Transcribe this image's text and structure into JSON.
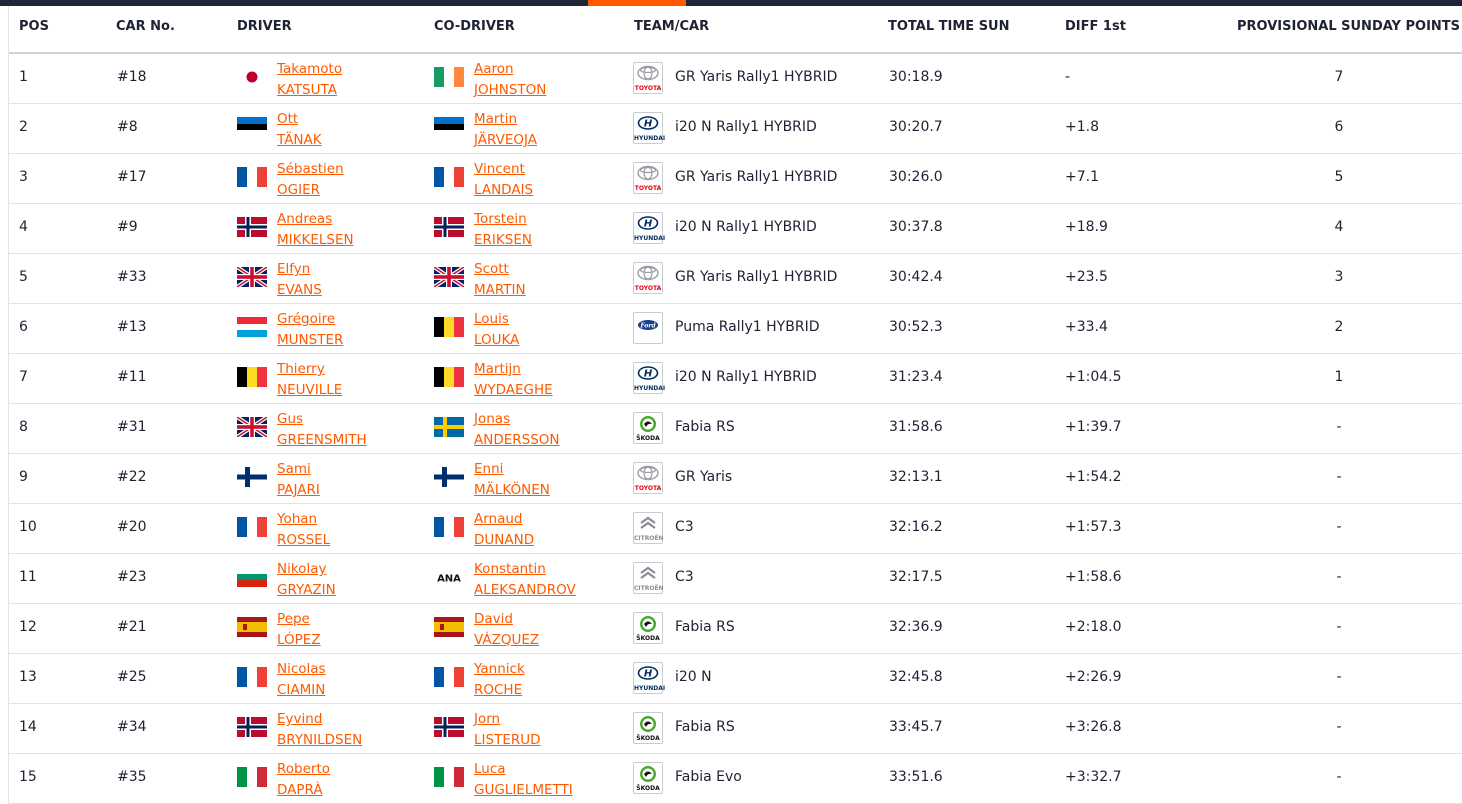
{
  "headers": {
    "pos": "POS",
    "car": "CAR No.",
    "driver": "DRIVER",
    "codriver": "CO-DRIVER",
    "team": "TEAM/CAR",
    "total": "TOTAL TIME SUN",
    "diff": "DIFF 1st",
    "points": "PROVISIONAL SUNDAY POINTS"
  },
  "rows": [
    {
      "pos": "1",
      "car": "#18",
      "driver_first": "Takamoto",
      "driver_last": "KATSUTA",
      "driver_flag": "JPN",
      "codriver_first": "Aaron",
      "codriver_last": "JOHNSTON",
      "codriver_flag": "IRL",
      "brand": "toyota",
      "brand_label": "TOYOTA",
      "model": "GR Yaris Rally1 HYBRID",
      "time": "30:18.9",
      "diff": "-",
      "points": "7"
    },
    {
      "pos": "2",
      "car": "#8",
      "driver_first": "Ott",
      "driver_last": "TÄNAK",
      "driver_flag": "EST",
      "codriver_first": "Martin",
      "codriver_last": "JÄRVEOJA",
      "codriver_flag": "EST",
      "brand": "hyundai",
      "brand_label": "HYUNDAI",
      "model": "i20 N Rally1 HYBRID",
      "time": "30:20.7",
      "diff": "+1.8",
      "points": "6"
    },
    {
      "pos": "3",
      "car": "#17",
      "driver_first": "Sébastien",
      "driver_last": "OGIER",
      "driver_flag": "FRA",
      "codriver_first": "Vincent",
      "codriver_last": "LANDAIS",
      "codriver_flag": "FRA",
      "brand": "toyota",
      "brand_label": "TOYOTA",
      "model": "GR Yaris Rally1 HYBRID",
      "time": "30:26.0",
      "diff": "+7.1",
      "points": "5"
    },
    {
      "pos": "4",
      "car": "#9",
      "driver_first": "Andreas",
      "driver_last": "MIKKELSEN",
      "driver_flag": "NOR",
      "codriver_first": "Torstein",
      "codriver_last": "ERIKSEN",
      "codriver_flag": "NOR",
      "brand": "hyundai",
      "brand_label": "HYUNDAI",
      "model": "i20 N Rally1 HYBRID",
      "time": "30:37.8",
      "diff": "+18.9",
      "points": "4"
    },
    {
      "pos": "5",
      "car": "#33",
      "driver_first": "Elfyn",
      "driver_last": "EVANS",
      "driver_flag": "GBR",
      "codriver_first": "Scott",
      "codriver_last": "MARTIN",
      "codriver_flag": "GBR",
      "brand": "toyota",
      "brand_label": "TOYOTA",
      "model": "GR Yaris Rally1 HYBRID",
      "time": "30:42.4",
      "diff": "+23.5",
      "points": "3"
    },
    {
      "pos": "6",
      "car": "#13",
      "driver_first": "Grégoire",
      "driver_last": "MUNSTER",
      "driver_flag": "LUX",
      "codriver_first": "Louis",
      "codriver_last": "LOUKA",
      "codriver_flag": "BEL",
      "brand": "ford",
      "brand_label": "Ford",
      "model": "Puma Rally1 HYBRID",
      "time": "30:52.3",
      "diff": "+33.4",
      "points": "2"
    },
    {
      "pos": "7",
      "car": "#11",
      "driver_first": "Thierry",
      "driver_last": "NEUVILLE",
      "driver_flag": "BEL",
      "codriver_first": "Martijn",
      "codriver_last": "WYDAEGHE",
      "codriver_flag": "BEL",
      "brand": "hyundai",
      "brand_label": "HYUNDAI",
      "model": "i20 N Rally1 HYBRID",
      "time": "31:23.4",
      "diff": "+1:04.5",
      "points": "1"
    },
    {
      "pos": "8",
      "car": "#31",
      "driver_first": "Gus",
      "driver_last": "GREENSMITH",
      "driver_flag": "GBR",
      "codriver_first": "Jonas",
      "codriver_last": "ANDERSSON",
      "codriver_flag": "SWE",
      "brand": "skoda",
      "brand_label": "ŠKODA",
      "model": "Fabia RS",
      "time": "31:58.6",
      "diff": "+1:39.7",
      "points": "-"
    },
    {
      "pos": "9",
      "car": "#22",
      "driver_first": "Sami",
      "driver_last": "PAJARI",
      "driver_flag": "FIN",
      "codriver_first": "Enni",
      "codriver_last": "MÄLKÖNEN",
      "codriver_flag": "FIN",
      "brand": "toyota",
      "brand_label": "TOYOTA",
      "model": "GR Yaris",
      "time": "32:13.1",
      "diff": "+1:54.2",
      "points": "-"
    },
    {
      "pos": "10",
      "car": "#20",
      "driver_first": "Yohan",
      "driver_last": "ROSSEL",
      "driver_flag": "FRA",
      "codriver_first": "Arnaud",
      "codriver_last": "DUNAND",
      "codriver_flag": "FRA",
      "brand": "citroen",
      "brand_label": "CITROËN",
      "model": "C3",
      "time": "32:16.2",
      "diff": "+1:57.3",
      "points": "-"
    },
    {
      "pos": "11",
      "car": "#23",
      "driver_first": "Nikolay",
      "driver_last": "GRYAZIN",
      "driver_flag": "BUL",
      "codriver_first": "Konstantin",
      "codriver_last": "ALEKSANDROV",
      "codriver_flag": "ANA",
      "codriver_flag_text": "ANA",
      "brand": "citroen",
      "brand_label": "CITROËN",
      "model": "C3",
      "time": "32:17.5",
      "diff": "+1:58.6",
      "points": "-"
    },
    {
      "pos": "12",
      "car": "#21",
      "driver_first": "Pepe",
      "driver_last": "LÓPEZ",
      "driver_flag": "ESP",
      "codriver_first": "David",
      "codriver_last": "VÁZQUEZ",
      "codriver_flag": "ESP",
      "brand": "skoda",
      "brand_label": "ŠKODA",
      "model": "Fabia RS",
      "time": "32:36.9",
      "diff": "+2:18.0",
      "points": "-"
    },
    {
      "pos": "13",
      "car": "#25",
      "driver_first": "Nicolas",
      "driver_last": "CIAMIN",
      "driver_flag": "FRA",
      "codriver_first": "Yannick",
      "codriver_last": "ROCHE",
      "codriver_flag": "FRA",
      "brand": "hyundai",
      "brand_label": "HYUNDAI",
      "model": "i20 N",
      "time": "32:45.8",
      "diff": "+2:26.9",
      "points": "-"
    },
    {
      "pos": "14",
      "car": "#34",
      "driver_first": "Eyvind",
      "driver_last": "BRYNILDSEN",
      "driver_flag": "NOR",
      "codriver_first": "Jorn",
      "codriver_last": "LISTERUD",
      "codriver_flag": "NOR",
      "brand": "skoda",
      "brand_label": "ŠKODA",
      "model": "Fabia RS",
      "time": "33:45.7",
      "diff": "+3:26.8",
      "points": "-"
    },
    {
      "pos": "15",
      "car": "#35",
      "driver_first": "Roberto",
      "driver_last": "DAPRÀ",
      "driver_flag": "ITA",
      "codriver_first": "Luca",
      "codriver_last": "GUGLIELMETTI",
      "codriver_flag": "ITA",
      "brand": "skoda",
      "brand_label": "ŠKODA",
      "model": "Fabia Evo",
      "time": "33:51.6",
      "diff": "+3:32.7",
      "points": "-"
    }
  ],
  "colors": {
    "accent": "#ff5a00",
    "topbar": "#20253a",
    "text": "#1e2233",
    "toyota": "#e60012",
    "hyundai": "#002c5f",
    "skoda": "#4ba82e",
    "citroen": "#8a8d93",
    "ford": "#1a3d8f"
  }
}
